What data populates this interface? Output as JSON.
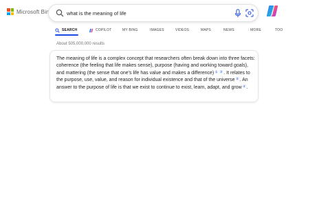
{
  "brand": {
    "name": "Microsoft Bing",
    "logo_colors": [
      "#f25022",
      "#7fba00",
      "#00a4ef",
      "#ffb900"
    ]
  },
  "search": {
    "query": "what is the meaning of life",
    "icons": [
      "search-icon",
      "microphone-icon",
      "visual-search-icon"
    ]
  },
  "copilot_button": {
    "icon": "copilot-logo-icon"
  },
  "tabs": [
    {
      "label": "SEARCH",
      "icon": "search-icon",
      "active": true
    },
    {
      "label": "COPILOT",
      "icon": "copilot-icon",
      "active": false
    },
    {
      "label": "MY BING",
      "active": false
    },
    {
      "label": "IMAGES",
      "active": false
    },
    {
      "label": "VIDEOS",
      "active": false
    },
    {
      "label": "MAPS",
      "active": false
    },
    {
      "label": "NEWS",
      "active": false
    },
    {
      "label": ": MORE",
      "active": false
    },
    {
      "label": "TOO",
      "active": false
    }
  ],
  "results": {
    "count_text": "About 505,000,000 results"
  },
  "answer": {
    "text_1": "The meaning of life is a complex concept that researchers often break down into three facets: coherence (the feeling that life makes sense), purpose (having and working toward goals), and mattering (the sense that one's life has value and makes a difference)",
    "cite_1": "1",
    "cite_2": "2",
    "text_2": ". It relates to the purpose, use, value, and reason for individual existence and that of the universe",
    "cite_3": "3",
    "text_3": ". An answer to the purpose of life is that we exist to continue to exist, learn, adapt, and grow",
    "cite_4": "4",
    "text_4": "."
  },
  "colors": {
    "accent": "#174ae4",
    "citation_bg": "#e8eefc",
    "citation_text": "#1a4fd8",
    "muted_text": "#70757a"
  }
}
